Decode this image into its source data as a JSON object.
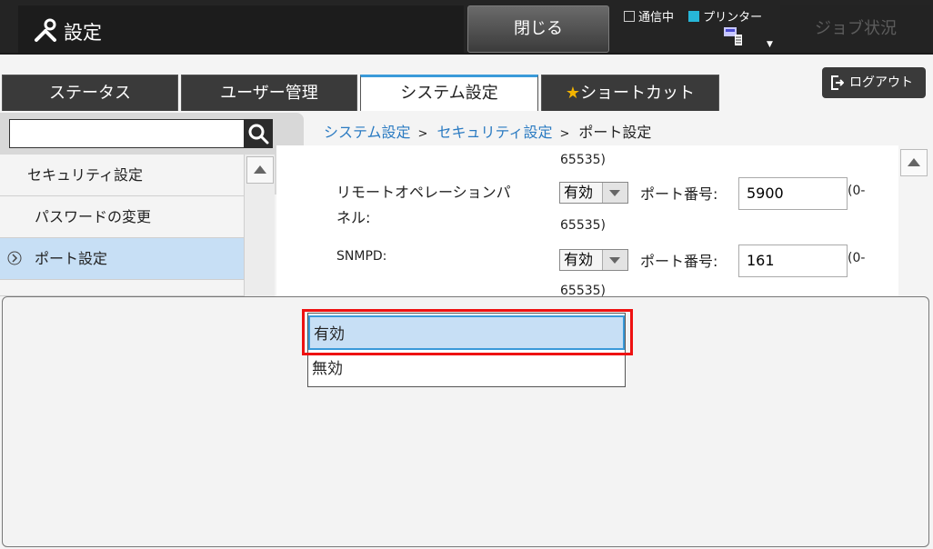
{
  "header": {
    "title": "設定",
    "close_label": "閉じる",
    "status_comm": "通信中",
    "status_printer": "プリンター",
    "job_status_label": "ジョブ状況",
    "accent": "#27b6d8"
  },
  "tabs": [
    {
      "label": "ステータス"
    },
    {
      "label": "ユーザー管理"
    },
    {
      "label": "システム設定"
    },
    {
      "label": "ショートカット"
    }
  ],
  "logout_label": "ログアウト",
  "search": {
    "value": ""
  },
  "breadcrumb": [
    {
      "label": "システム設定"
    },
    {
      "label": "セキュリティ設定"
    },
    {
      "label": "ポート設定"
    }
  ],
  "nav": [
    {
      "label": "セキュリティ設定"
    },
    {
      "label": "パスワードの変更"
    },
    {
      "label": "ポート設定"
    }
  ],
  "content": {
    "range_tail_1": "65535)",
    "row1_label_a": "リモートオペレーションパ",
    "row1_label_b": "ネル:",
    "row1_select": "有効",
    "row1_port_label": "ポート番号:",
    "row1_port": "5900",
    "row1_range_head": "(0-",
    "range_tail_2": "65535)",
    "row2_label": "SNMPD:",
    "row2_select": "有効",
    "row2_port_label": "ポート番号:",
    "row2_port": "161",
    "row2_range_head": "(0-",
    "range_tail_3": "65535)"
  },
  "dropdown": {
    "options": [
      {
        "label": "有効",
        "selected": true
      },
      {
        "label": "無効",
        "selected": false
      }
    ]
  }
}
